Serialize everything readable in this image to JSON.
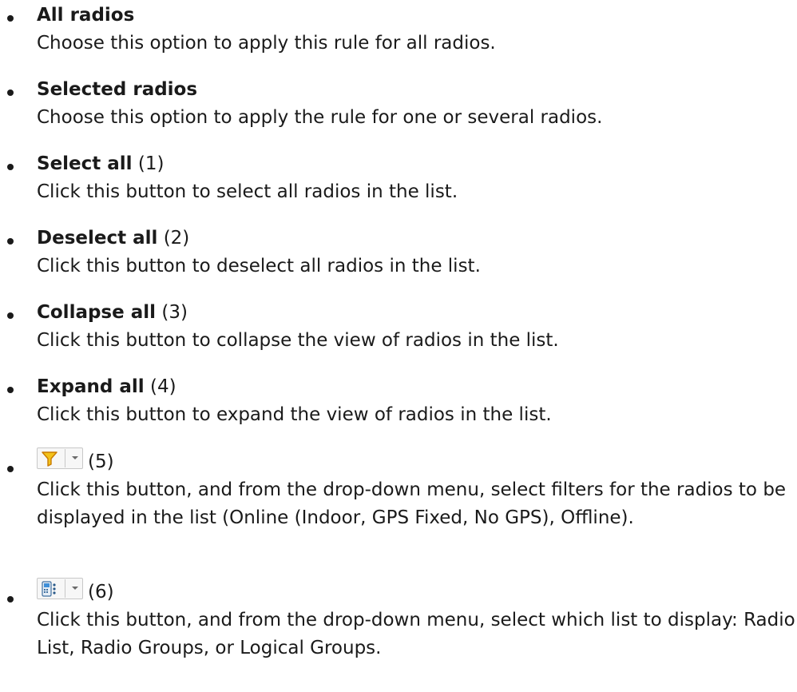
{
  "items": [
    {
      "title": "All radios",
      "num": "",
      "desc": "Choose this option to apply this rule for all radios."
    },
    {
      "title": "Selected radios",
      "num": "",
      "desc": "Choose this option to apply the rule for one or several radios."
    },
    {
      "title": "Select all",
      "num": " (1)",
      "desc": "Click this button to select all radios in the list."
    },
    {
      "title": "Deselect all",
      "num": " (2)",
      "desc": "Click this button to deselect all radios in the list."
    },
    {
      "title": "Collapse all",
      "num": " (3)",
      "desc": "Click this button to collapse the view of radios in the list."
    },
    {
      "title": "Expand all",
      "num": " (4)",
      "desc": "Click this button to expand the view of radios in the list."
    },
    {
      "icon": "filter-funnel-dropdown-icon",
      "num": "(5)",
      "desc": "Click this button, and from the drop-down menu, select filters for the radios to be displayed in the list (Online (Indoor, GPS Fixed, No GPS), Offline)."
    },
    {
      "icon": "radio-list-dropdown-icon",
      "num": "(6)",
      "desc": "Click this button, and from the drop-down menu, select which list to display: Radio List, Radio Groups, or Logical Groups."
    }
  ],
  "colors": {
    "text": "#1a1a1a",
    "funnel": "#f2c21b",
    "funnel_outline": "#c97a00",
    "device": "#3f8fd8"
  }
}
